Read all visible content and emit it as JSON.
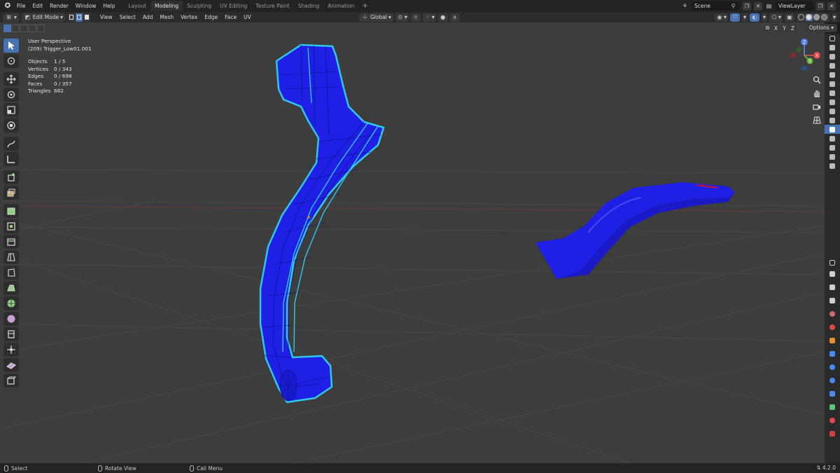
{
  "topbar": {
    "menus": [
      "File",
      "Edit",
      "Render",
      "Window",
      "Help"
    ],
    "workspaces": [
      "Layout",
      "Modeling",
      "Sculpting",
      "UV Editing",
      "Texture Paint",
      "Shading",
      "Animation"
    ],
    "active_workspace": "Modeling",
    "add_tab": "+",
    "scene_label": "Scene",
    "view_layer_label": "ViewLayer"
  },
  "header": {
    "mode": "Edit Mode",
    "menus": [
      "View",
      "Select",
      "Add",
      "Mesh",
      "Vertex",
      "Edge",
      "Face",
      "UV"
    ],
    "orientation": "Global"
  },
  "tool_settings": {
    "axes": [
      "X",
      "Y",
      "Z"
    ],
    "options_label": "Options"
  },
  "viewport_overlay": {
    "view_name": "User Perspective",
    "object_name": "(209) Trigger_Low01.001",
    "stats": [
      {
        "label": "Objects",
        "value": "1 / 5"
      },
      {
        "label": "Vertices",
        "value": "0 / 343"
      },
      {
        "label": "Edges",
        "value": "0 / 698"
      },
      {
        "label": "Faces",
        "value": "0 / 357"
      },
      {
        "label": "Triangles",
        "value": "682"
      }
    ]
  },
  "gizmo": {
    "x": "X",
    "y": "Y",
    "z": "Z"
  },
  "status_bar": {
    "left": "Select",
    "middle": "Rotate View",
    "right": "Call Menu",
    "version": "4.2.0"
  },
  "colors": {
    "mesh_fill": "#1f1fe6",
    "selection_outline": "#2fc8e8",
    "active_accent": "#4772b3",
    "viewport_bg": "#3d3d3d"
  }
}
